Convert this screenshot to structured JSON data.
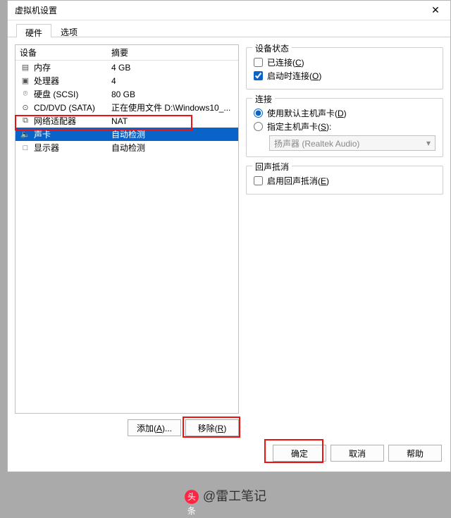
{
  "window": {
    "title": "虚拟机设置"
  },
  "tabs": {
    "hardware": "硬件",
    "options": "选项",
    "active": "hardware"
  },
  "hwlist": {
    "headers": {
      "device": "设备",
      "summary": "摘要"
    },
    "rows": [
      {
        "icon": "▤",
        "device": "内存",
        "summary": "4 GB"
      },
      {
        "icon": "▣",
        "device": "处理器",
        "summary": "4"
      },
      {
        "icon": "⌾",
        "device": "硬盘 (SCSI)",
        "summary": "80 GB"
      },
      {
        "icon": "⊙",
        "device": "CD/DVD (SATA)",
        "summary": "正在使用文件 D:\\Windows10_..."
      },
      {
        "icon": "⧉",
        "device": "网络适配器",
        "summary": "NAT"
      },
      {
        "icon": "🔈",
        "device": "声卡",
        "summary": "自动检测"
      },
      {
        "icon": "□",
        "device": "显示器",
        "summary": "自动检测"
      }
    ],
    "selected_index": 5
  },
  "device_status": {
    "legend": "设备状态",
    "connected": {
      "label": "已连接(",
      "hotkey": "C",
      "end": ")",
      "checked": false
    },
    "connect_at_poweron": {
      "label": "启动时连接(",
      "hotkey": "O",
      "end": ")",
      "checked": true
    }
  },
  "connection": {
    "legend": "连接",
    "use_default": {
      "label": "使用默认主机声卡(",
      "hotkey": "D",
      "end": ")",
      "checked": true
    },
    "specify": {
      "label": "指定主机声卡(",
      "hotkey": "S",
      "end": "):",
      "checked": false
    },
    "device_select": "扬声器 (Realtek Audio)"
  },
  "echo": {
    "legend": "回声抵消",
    "enable": {
      "label": "启用回声抵消(",
      "hotkey": "E",
      "end": ")",
      "checked": false
    }
  },
  "buttons": {
    "add": {
      "label": "添加(",
      "hotkey": "A",
      "end": ")..."
    },
    "remove": {
      "label": "移除(",
      "hotkey": "R",
      "end": ")"
    },
    "ok": "确定",
    "cancel": "取消",
    "help": "帮助"
  },
  "watermark": {
    "brand": "头条",
    "author": "@雷工笔记"
  }
}
